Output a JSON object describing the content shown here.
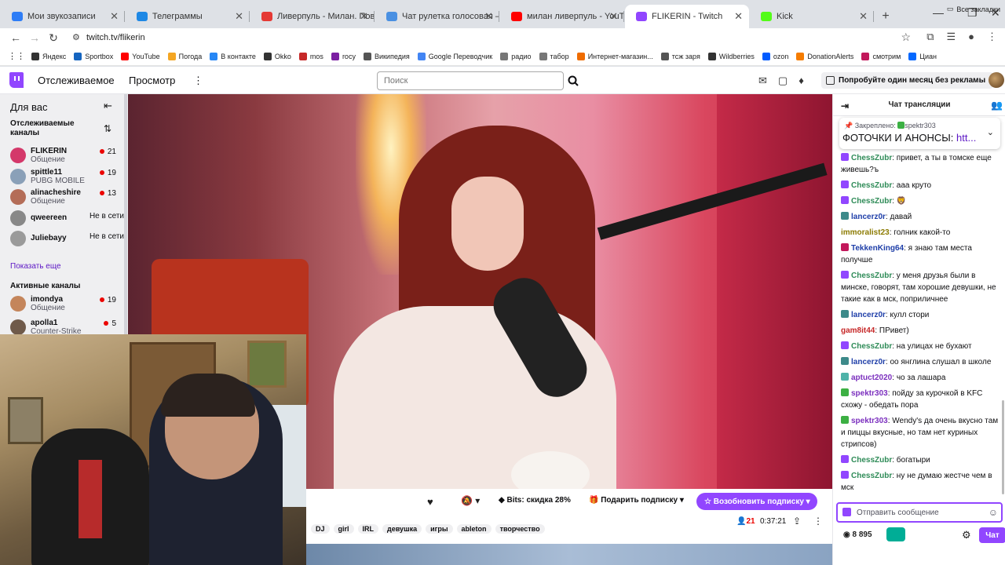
{
  "browser": {
    "tabs": [
      {
        "title": "Мои звукозаписи",
        "color": "#2e7df6",
        "active": false
      },
      {
        "title": "Телеграммы",
        "color": "#1e88e5",
        "active": false
      },
      {
        "title": "Ливерпуль - Милан. Повтор м",
        "color": "#e53935",
        "active": false
      },
      {
        "title": "Чат рулетка голосовая — Net",
        "color": "#4a90e2",
        "active": false
      },
      {
        "title": "милан ливерпуль - YouTube",
        "color": "#ff0000",
        "active": false
      },
      {
        "title": "FLIKERIN - Twitch",
        "color": "#9146ff",
        "active": true
      },
      {
        "title": "Kick",
        "color": "#53fc18",
        "active": false
      }
    ],
    "url": "twitch.tv/flikerin",
    "bookmarks": [
      {
        "label": "Яндекс",
        "color": "#333"
      },
      {
        "label": "Sportbox",
        "color": "#1565c0"
      },
      {
        "label": "YouTube",
        "color": "#ff0000"
      },
      {
        "label": "Погода",
        "color": "#f4a623"
      },
      {
        "label": "В контакте",
        "color": "#2787f5"
      },
      {
        "label": "Okko",
        "color": "#333"
      },
      {
        "label": "mos",
        "color": "#c62828"
      },
      {
        "label": "rocy",
        "color": "#7b1fa2"
      },
      {
        "label": "Википедия",
        "color": "#555"
      },
      {
        "label": "Google Переводчик",
        "color": "#4285f4"
      },
      {
        "label": "радио",
        "color": "#777"
      },
      {
        "label": "табор",
        "color": "#777"
      },
      {
        "label": "Интернет-магазин...",
        "color": "#ef6c00"
      },
      {
        "label": "тсж заря",
        "color": "#555"
      },
      {
        "label": "Wildberries",
        "color": "#333"
      },
      {
        "label": "ozon",
        "color": "#005bff"
      },
      {
        "label": "DonationAlerts",
        "color": "#f57c00"
      },
      {
        "label": "смотрим",
        "color": "#c2185b"
      },
      {
        "label": "Циан",
        "color": "#0468ff"
      }
    ],
    "all_bookmarks": "Все закладки"
  },
  "twitch": {
    "nav": {
      "following": "Отслеживаемое",
      "browse": "Просмотр",
      "more": "⋮"
    },
    "search_placeholder": "Поиск",
    "promo": "Попробуйте один месяц без рекламы"
  },
  "sidebar": {
    "header": "Для вас",
    "followed_title": "Отслеживаемые каналы",
    "followed": [
      {
        "name": "FLIKERIN",
        "game": "Общение",
        "viewers": "21",
        "color": "#d4386a"
      },
      {
        "name": "spittle11",
        "game": "PUBG MOBILE",
        "viewers": "19",
        "color": "#8aa0b8"
      },
      {
        "name": "alinacheshire",
        "game": "Общение",
        "viewers": "13",
        "color": "#b46d58"
      },
      {
        "name": "qweereen",
        "status": "Не в сети",
        "color": "#888"
      },
      {
        "name": "Juliebayy",
        "status": "Не в сети",
        "color": "#9a9a9a"
      }
    ],
    "show_more": "Показать еще",
    "active_title": "Активные каналы",
    "active": [
      {
        "name": "imondya",
        "game": "Общение",
        "viewers": "19",
        "color": "#c4855b"
      },
      {
        "name": "apolla1",
        "game": "Counter-Strike",
        "viewers": "5",
        "color": "#6f5a4a"
      }
    ]
  },
  "player": {
    "bits": "Bits: скидка 28%",
    "gift": "Подарить подписку",
    "renew": "Возобновить подписку",
    "viewers": "21",
    "uptime": "0:37:21",
    "tags": [
      "DJ",
      "girl",
      "IRL",
      "девушка",
      "игры",
      "ableton",
      "творчество"
    ]
  },
  "chat": {
    "title": "Чат трансляции",
    "pinned_label": "Закреплено:",
    "pinned_by": "spektr303",
    "pinned_text": "ФОТОЧКИ И АНОНСЫ: ",
    "pinned_link": "htt...",
    "messages": [
      {
        "user": "ChessZubr",
        "color": "#2e8b57",
        "badge": "#9146ff",
        "text": "привет, а ты в томске еще живешь?ъ"
      },
      {
        "user": "ChessZubr",
        "color": "#2e8b57",
        "badge": "#9146ff",
        "text": "ааа круто"
      },
      {
        "user": "ChessZubr",
        "color": "#2e8b57",
        "badge": "#9146ff",
        "text": "🦁"
      },
      {
        "user": "lancerz0r",
        "color": "#1e3ea8",
        "badge": "#3d8a8a",
        "text": "давай"
      },
      {
        "user": "immoralist23",
        "color": "#8b7a00",
        "badge": "",
        "text": "голник какой-то"
      },
      {
        "user": "TekkenKing64",
        "color": "#1e3ea8",
        "badge": "#c2185b",
        "text": "я знаю там места получше"
      },
      {
        "user": "ChessZubr",
        "color": "#2e8b57",
        "badge": "#9146ff",
        "text": "у меня друзья были в минске, говорят, там хорошие девушки, не такие как в мск, поприличнее"
      },
      {
        "user": "lancerz0r",
        "color": "#1e3ea8",
        "badge": "#3d8a8a",
        "text": "кулл стори"
      },
      {
        "user": "gam8it44",
        "color": "#c62828",
        "badge": "",
        "text": "ПРивет)"
      },
      {
        "user": "ChessZubr",
        "color": "#2e8b57",
        "badge": "#9146ff",
        "text": "на улицах не бухают"
      },
      {
        "user": "lancerz0r",
        "color": "#1e3ea8",
        "badge": "#3d8a8a",
        "text": "оо янглина слушал в школе"
      },
      {
        "user": "aptuct2020",
        "color": "#7b2fbe",
        "badge": "#4fb3a9",
        "text": "чо за лашара"
      },
      {
        "user": "spektr303",
        "color": "#7b2fbe",
        "badge": "#3cb043",
        "text": "пойду за курочкой в KFC схожу - обедать пора"
      },
      {
        "user": "spektr303",
        "color": "#7b2fbe",
        "badge": "#3cb043",
        "text": "Wendy's да очень вкусно там и пиццы вкусные, но там нет куриных стрипсов)"
      },
      {
        "user": "ChessZubr",
        "color": "#2e8b57",
        "badge": "#9146ff",
        "text": "богатыри"
      },
      {
        "user": "ChessZubr",
        "color": "#2e8b57",
        "badge": "#9146ff",
        "text": "ну не думаю жестче чем в мск"
      }
    ],
    "input_placeholder": "Отправить сообщение",
    "points": "8 895",
    "chat_button": "Чат"
  }
}
